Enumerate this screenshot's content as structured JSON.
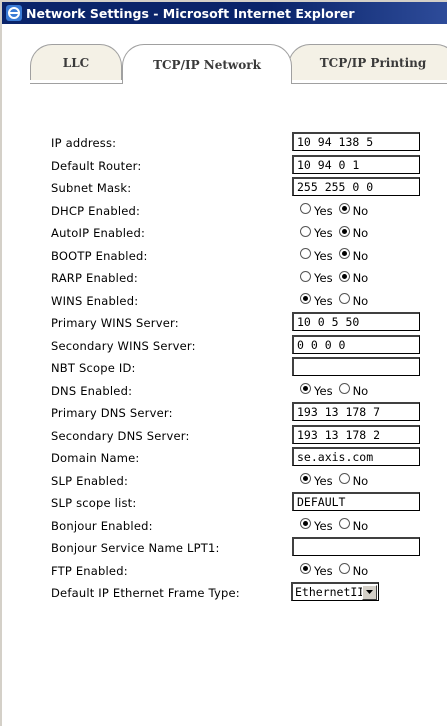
{
  "window": {
    "title": "Network Settings - Microsoft Internet Explorer"
  },
  "tabs": [
    {
      "label": "LLC",
      "active": false
    },
    {
      "label": "TCP/IP Network",
      "active": true
    },
    {
      "label": "TCP/IP Printing",
      "active": false
    }
  ],
  "form": {
    "ip_address": {
      "label": "IP address:",
      "value": "10 94 138 5"
    },
    "default_router": {
      "label": "Default Router:",
      "value": "10 94 0 1"
    },
    "subnet_mask": {
      "label": "Subnet Mask:",
      "value": "255 255 0 0"
    },
    "dhcp_enabled": {
      "label": "DHCP Enabled:",
      "yes": "Yes",
      "no": "No",
      "selected": "No"
    },
    "autoip_enabled": {
      "label": "AutoIP Enabled:",
      "yes": "Yes",
      "no": "No",
      "selected": "No"
    },
    "bootp_enabled": {
      "label": "BOOTP Enabled:",
      "yes": "Yes",
      "no": "No",
      "selected": "No"
    },
    "rarp_enabled": {
      "label": "RARP Enabled:",
      "yes": "Yes",
      "no": "No",
      "selected": "No"
    },
    "wins_enabled": {
      "label": "WINS Enabled:",
      "yes": "Yes",
      "no": "No",
      "selected": "Yes"
    },
    "primary_wins": {
      "label": "Primary WINS Server:",
      "value": "10 0 5 50"
    },
    "secondary_wins": {
      "label": "Secondary WINS Server:",
      "value": "0 0 0 0"
    },
    "nbt_scope": {
      "label": "NBT Scope ID:",
      "value": ""
    },
    "dns_enabled": {
      "label": "DNS Enabled:",
      "yes": "Yes",
      "no": "No",
      "selected": "Yes"
    },
    "primary_dns": {
      "label": "Primary DNS Server:",
      "value": "193 13 178 7"
    },
    "secondary_dns": {
      "label": "Secondary DNS Server:",
      "value": "193 13 178 2"
    },
    "domain_name": {
      "label": "Domain Name:",
      "value": "se.axis.com"
    },
    "slp_enabled": {
      "label": "SLP Enabled:",
      "yes": "Yes",
      "no": "No",
      "selected": "Yes"
    },
    "slp_scope": {
      "label": "SLP scope list:",
      "value": "DEFAULT"
    },
    "bonjour_enabled": {
      "label": "Bonjour Enabled:",
      "yes": "Yes",
      "no": "No",
      "selected": "Yes"
    },
    "bonjour_service_name": {
      "label": "Bonjour Service Name LPT1:",
      "value": ""
    },
    "ftp_enabled": {
      "label": "FTP Enabled:",
      "yes": "Yes",
      "no": "No",
      "selected": "Yes"
    },
    "frame_type": {
      "label": "Default IP Ethernet Frame Type:",
      "value": "EthernetII"
    }
  },
  "icons": {
    "browser": "ie-icon",
    "dropdown": "chevron-down-icon"
  }
}
